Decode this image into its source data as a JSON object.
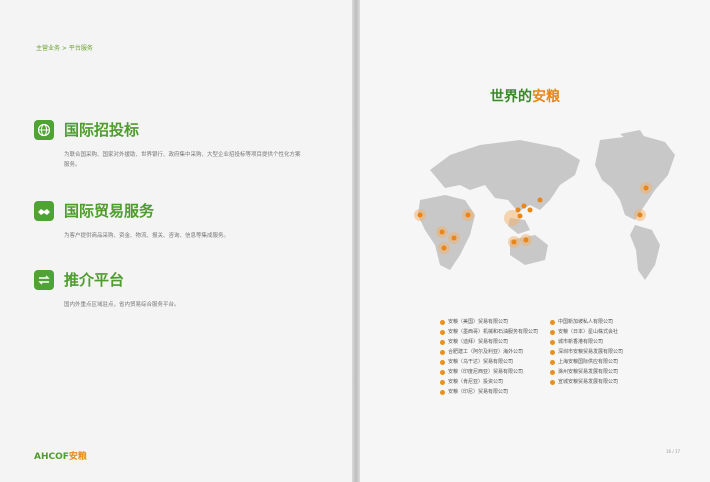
{
  "breadcrumb": "主营业务 > 平台服务",
  "services": [
    {
      "title": "国际招投标",
      "desc": "为联合国采购、国家对外援助、世界银行、政府集中采购、大型企业招投标等项目提供个性化方案服务。",
      "icon": "globe-icon"
    },
    {
      "title": "国际贸易服务",
      "desc": "为客户提供商品采购、资金、物流、报关、咨询、信息等集成服务。",
      "icon": "handshake-icon"
    },
    {
      "title": "推介平台",
      "desc": "国内外重点区域驻点，省内贸易综合服务平台。",
      "icon": "exchange-arrows-icon"
    }
  ],
  "logo": {
    "latin": "AHCOF",
    "cn": "安粮"
  },
  "map_title": {
    "prefix": "世界的",
    "accent": "安粮"
  },
  "legend_left": [
    "安粮（美国）贸易有限公司",
    "安粮（墨西哥）机械和石油服务有限公司",
    "安粮（迪拜）贸易有限公司",
    "合肥建工（阿尔及利亚）海外公司",
    "安粮（乌干达）贸易有限公司",
    "安粮（印度尼西亚）贸易有限公司",
    "安粮（肯尼亚）投资公司",
    "安粮（印尼）贸易有限公司"
  ],
  "legend_right": [
    "中国新加坡私人有限公司",
    "安粮（日本）星山株式会社",
    "城市新香港有限公司",
    "深圳市安粮贸易发展有限公司",
    "上海安粮国际供应有限公司",
    "滁州安粮贸易发展有限公司",
    "宣城安粮贸易发展有限公司"
  ],
  "page_number": "16 / 17",
  "colors": {
    "green": "#4f9c2f",
    "orange": "#e8861a"
  }
}
